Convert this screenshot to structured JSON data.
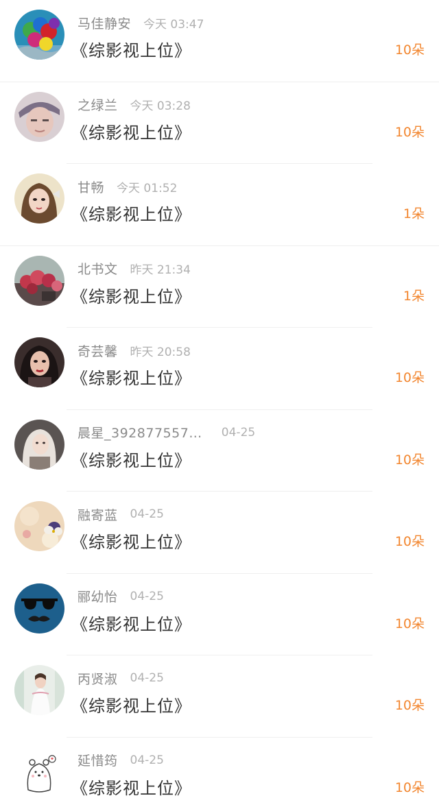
{
  "accent_color": "#f2862f",
  "items": [
    {
      "username": "马佳静安",
      "time": "今天 03:47",
      "title": "《综影视上位》",
      "count": "10朵",
      "avatar_icon": "balloons-avatar-icon"
    },
    {
      "username": "之绿兰",
      "time": "今天 03:28",
      "title": "《综影视上位》",
      "count": "10朵",
      "avatar_icon": "person-avatar-icon"
    },
    {
      "username": "甘畅",
      "time": "今天 01:52",
      "title": "《综影视上位》",
      "count": "1朵",
      "avatar_icon": "girl-avatar-icon"
    },
    {
      "username": "北书文",
      "time": "昨天 21:34",
      "title": "《综影视上位》",
      "count": "1朵",
      "avatar_icon": "flowers-avatar-icon"
    },
    {
      "username": "奇芸馨",
      "time": "昨天 20:58",
      "title": "《综影视上位》",
      "count": "10朵",
      "avatar_icon": "woman-avatar-icon"
    },
    {
      "username": "晨星_392877557…",
      "time": "04-25",
      "title": "《综影视上位》",
      "count": "10朵",
      "avatar_icon": "illustration-avatar-icon"
    },
    {
      "username": "融寄蓝",
      "time": "04-25",
      "title": "《综影视上位》",
      "count": "10朵",
      "avatar_icon": "pansy-avatar-icon"
    },
    {
      "username": "郦幼怡",
      "time": "04-25",
      "title": "《综影视上位》",
      "count": "10朵",
      "avatar_icon": "sunglasses-avatar-icon"
    },
    {
      "username": "丙贤淑",
      "time": "04-25",
      "title": "《综影视上位》",
      "count": "10朵",
      "avatar_icon": "bride-avatar-icon"
    },
    {
      "username": "延惜筠",
      "time": "04-25",
      "title": "《综影视上位》",
      "count": "10朵",
      "avatar_icon": "bear-avatar-icon"
    }
  ]
}
